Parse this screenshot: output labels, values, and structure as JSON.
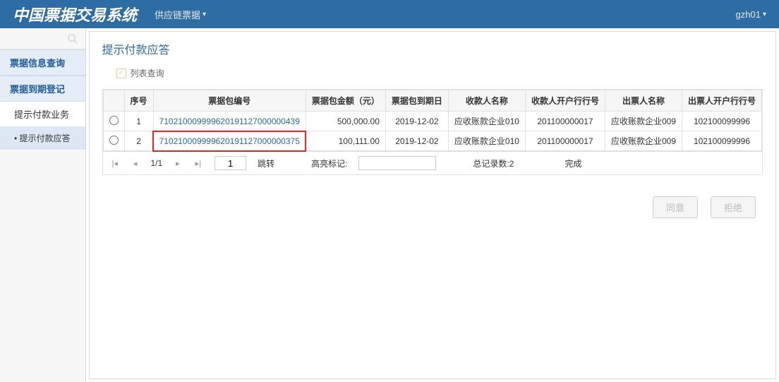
{
  "topbar": {
    "title": "中国票据交易系统",
    "menu": "供应链票据",
    "user": "gzh01"
  },
  "sidebar": {
    "block1": "票据信息查询",
    "block2": "票据到期登记",
    "sub1": "提示付款业务",
    "sub2": "• 提示付款应答"
  },
  "page": {
    "title": "提示付款应答",
    "fieldset": "列表查询"
  },
  "columns": {
    "c0": "",
    "c1": "序号",
    "c2": "票据包编号",
    "c3": "票据包金额（元）",
    "c4": "票据包到期日",
    "c5": "收款人名称",
    "c6": "收款人开户行行号",
    "c7": "出票人名称",
    "c8": "出票人开户行行号"
  },
  "rows": [
    {
      "idx": "1",
      "no": "710210009999620191127000000439",
      "amt": "500,000.00",
      "due": "2019-12-02",
      "payee": "应收账款企业010",
      "payeeBank": "201100000017",
      "drawer": "应收账款企业009",
      "drawerBank": "102100099996"
    },
    {
      "idx": "2",
      "no": "710210009999620191127000000375",
      "amt": "100,111.00",
      "due": "2019-12-02",
      "payee": "应收账款企业010",
      "payeeBank": "201100000017",
      "drawer": "应收账款企业009",
      "drawerBank": "102100099996"
    }
  ],
  "pager": {
    "page": "1/1",
    "goto_value": "1",
    "goto_label": "跳转",
    "highlight_label": "高亮标记:",
    "total_label": "总记录数:2",
    "status": "完成"
  },
  "actions": {
    "agree": "同意",
    "reject": "拒绝"
  }
}
